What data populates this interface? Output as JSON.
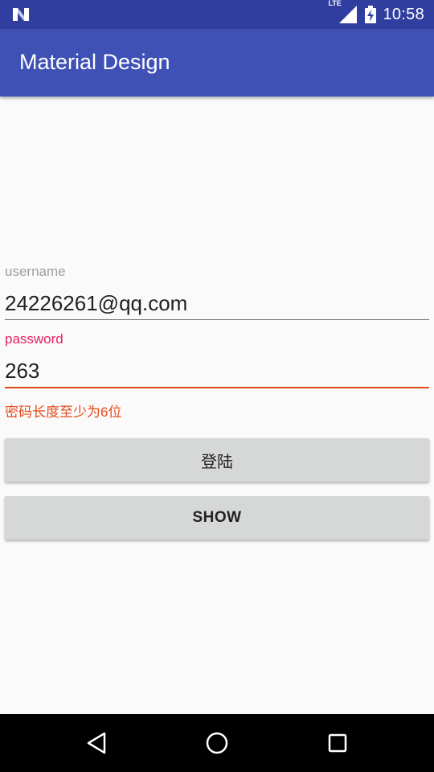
{
  "status_bar": {
    "network_label": "LTE",
    "time": "10:58",
    "icons": [
      "n-logo-icon",
      "signal-icon",
      "battery-charging-icon"
    ]
  },
  "app_bar": {
    "title": "Material Design"
  },
  "form": {
    "username": {
      "label": "username",
      "value": "24226261@qq.com"
    },
    "password": {
      "label": "password",
      "value": "263",
      "error": "密码长度至少为6位"
    }
  },
  "buttons": {
    "login_label": "登陆",
    "show_label": "SHOW"
  },
  "nav_bar": {
    "icons": [
      "back-icon",
      "home-icon",
      "recents-icon"
    ]
  },
  "colors": {
    "status_bar": "#303f9f",
    "app_bar": "#3f51b5",
    "accent": "#e91e63",
    "error": "#e64a19",
    "button": "#d6d7d7"
  }
}
